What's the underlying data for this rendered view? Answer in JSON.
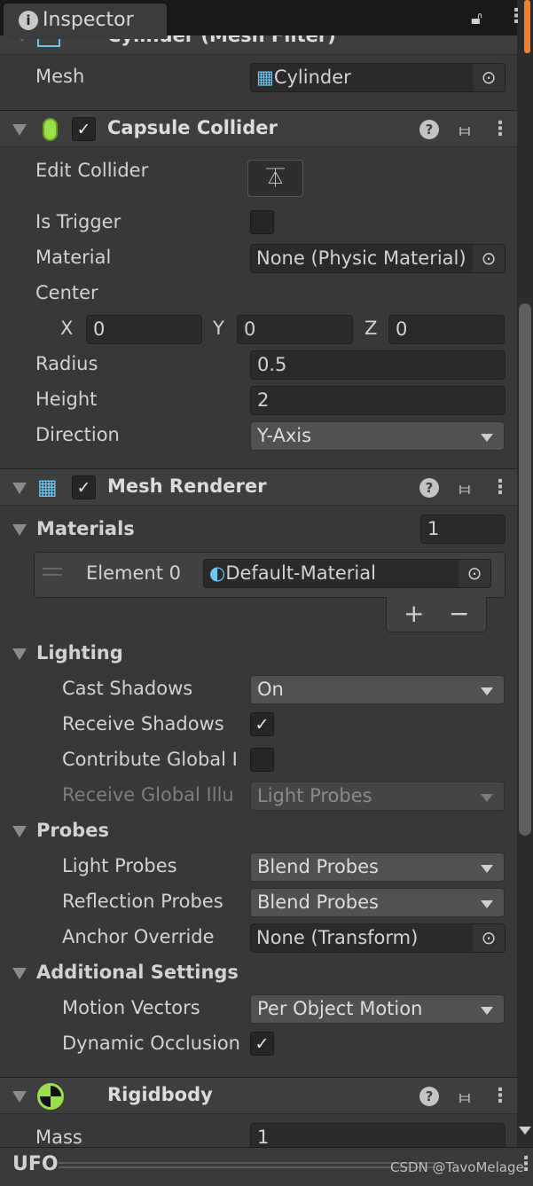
{
  "tab": {
    "title": "Inspector"
  },
  "mesh_filter": {
    "title": "Cylinder (Mesh Filter)",
    "mesh_label": "Mesh",
    "mesh_value": "Cylinder"
  },
  "capsule": {
    "title": "Capsule Collider",
    "enabled": true,
    "edit_collider": "Edit Collider",
    "is_trigger": "Is Trigger",
    "is_trigger_value": false,
    "material": "Material",
    "material_value": "None (Physic Material)",
    "center": "Center",
    "x_label": "X",
    "x": "0",
    "y_label": "Y",
    "y": "0",
    "z_label": "Z",
    "z": "0",
    "radius": "Radius",
    "radius_value": "0.5",
    "height": "Height",
    "height_value": "2",
    "direction": "Direction",
    "direction_value": "Y-Axis"
  },
  "renderer": {
    "title": "Mesh Renderer",
    "enabled": true,
    "materials": "Materials",
    "materials_count": "1",
    "element0": "Element 0",
    "element0_value": "Default-Material",
    "add": "+",
    "remove": "−",
    "lighting": "Lighting",
    "cast_shadows": "Cast Shadows",
    "cast_shadows_value": "On",
    "receive_shadows": "Receive Shadows",
    "receive_shadows_value": true,
    "contribute_gi": "Contribute Global I",
    "contribute_gi_value": false,
    "receive_gi": "Receive Global Illu",
    "receive_gi_value": "Light Probes",
    "probes": "Probes",
    "light_probes": "Light Probes",
    "light_probes_value": "Blend Probes",
    "reflection_probes": "Reflection Probes",
    "reflection_probes_value": "Blend Probes",
    "anchor": "Anchor Override",
    "anchor_value": "None (Transform)",
    "additional": "Additional Settings",
    "motion_vectors": "Motion Vectors",
    "motion_vectors_value": "Per Object Motion",
    "dynamic_occlusion": "Dynamic Occlusion",
    "dynamic_occlusion_value": true
  },
  "rigidbody": {
    "title": "Rigidbody",
    "mass": "Mass",
    "mass_value": "1"
  },
  "footer": {
    "object": "UFO",
    "watermark": "CSDN @TavoMelage"
  },
  "colors": {
    "accent": "#f47f2a",
    "collider_green": "#9be04a",
    "mesh_blue": "#6cc6f0"
  }
}
